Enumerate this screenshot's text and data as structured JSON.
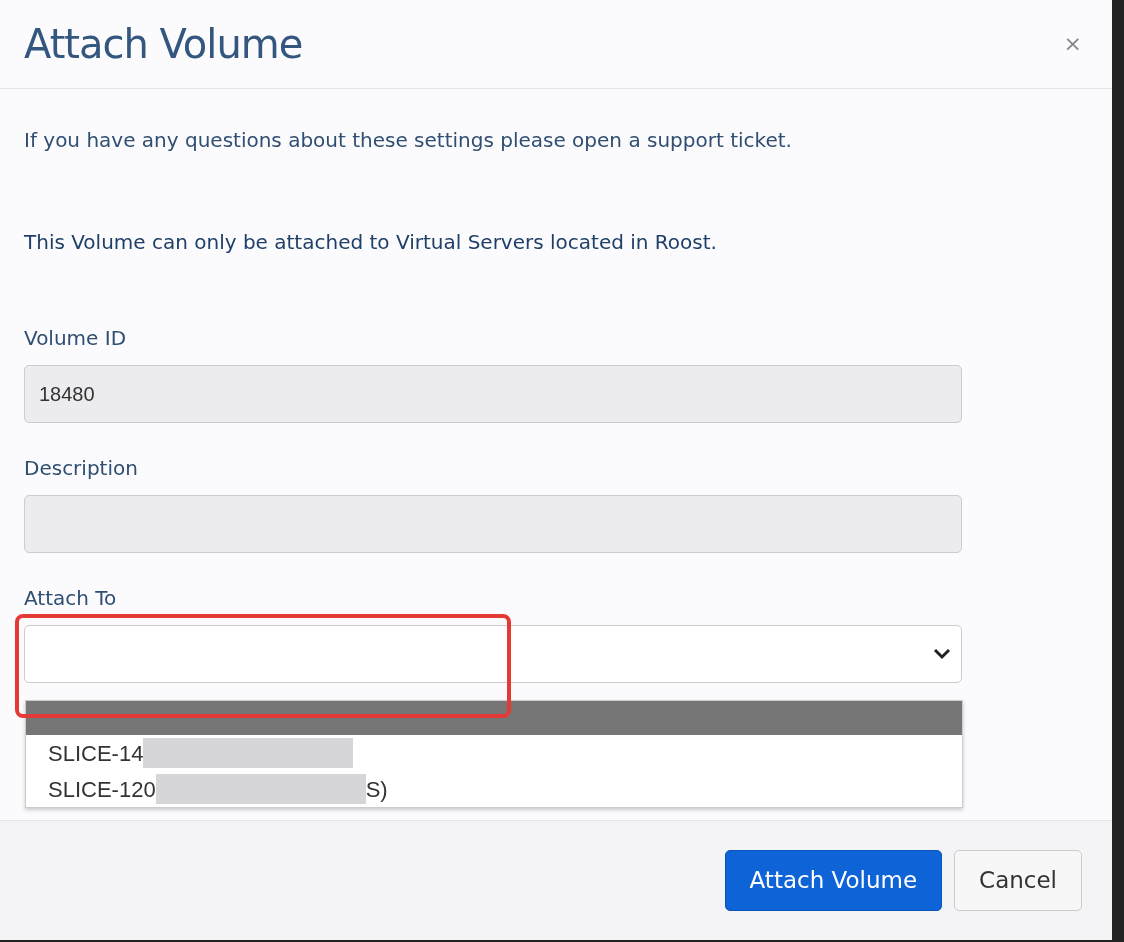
{
  "dialog": {
    "title": "Attach Volume",
    "close": "×"
  },
  "notice": "If you have any questions about these settings please open a support ticket.",
  "restriction": "This Volume can only be attached to Virtual Servers located in Roost.",
  "fields": [
    {
      "label": "Volume ID",
      "value": "18480",
      "disabled": true
    },
    {
      "label": "Description",
      "disabled": true
    }
  ],
  "attach_to": {
    "label": "Attach To",
    "expanded": true,
    "highlighted": true,
    "options": [
      {
        "selected": true
      },
      {
        "text": "SLICE-14",
        "selected": false
      },
      {
        "text": "SLICE-120",
        "tail": "S)",
        "selected": false
      }
    ]
  },
  "buttons": [
    {
      "label": "Attach Volume",
      "kind": "primary"
    },
    {
      "label": "Cancel",
      "kind": "secondary"
    }
  ]
}
